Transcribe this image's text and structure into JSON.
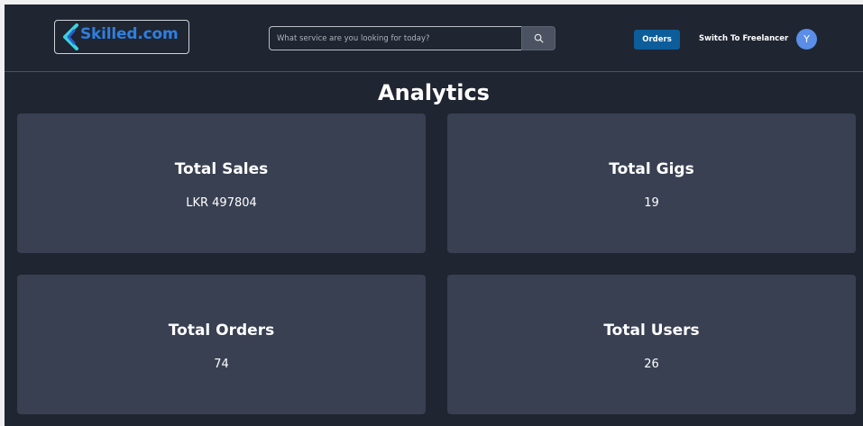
{
  "header": {
    "logo_text": "Skilled.com",
    "search": {
      "placeholder": "What service are you looking for today?",
      "value": "",
      "button_icon": "search-icon"
    },
    "orders_label": "Orders",
    "switch_label": "Switch To Freelancer",
    "avatar_initial": "Y"
  },
  "main": {
    "title": "Analytics",
    "cards": [
      {
        "title": "Total Sales",
        "value": "LKR 497804"
      },
      {
        "title": "Total Gigs",
        "value": "19"
      },
      {
        "title": "Total Orders",
        "value": "74"
      },
      {
        "title": "Total Users",
        "value": "26"
      }
    ]
  },
  "colors": {
    "background": "#1f2531",
    "card": "#384052",
    "brand_blue": "#2e7fe0",
    "orders_button": "#0d5d9b",
    "avatar": "#5a8ee8"
  }
}
